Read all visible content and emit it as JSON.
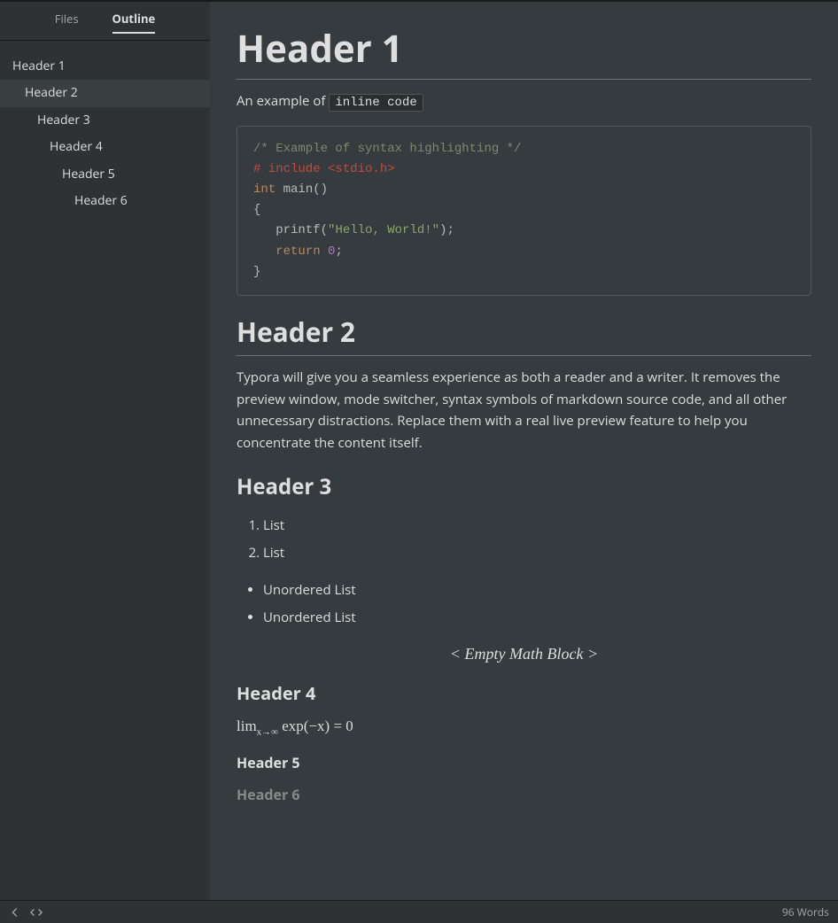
{
  "sidebar": {
    "tabs": {
      "files": "Files",
      "outline": "Outline"
    },
    "outline": [
      {
        "label": "Header 1",
        "level": 1,
        "active": false
      },
      {
        "label": "Header 2",
        "level": 2,
        "active": true
      },
      {
        "label": "Header 3",
        "level": 3,
        "active": false
      },
      {
        "label": "Header 4",
        "level": 4,
        "active": false
      },
      {
        "label": "Header 5",
        "level": 5,
        "active": false
      },
      {
        "label": "Header 6",
        "level": 6,
        "active": false
      }
    ]
  },
  "doc": {
    "h1": "Header 1",
    "p1_prefix": "An example of ",
    "inline_code": "inline code",
    "code": {
      "comment": "/* Example of syntax highlighting */",
      "preproc": "# include <stdio.h>",
      "line3_type": "int",
      "line3_func": "main",
      "line3_rest": "()",
      "line4": "{",
      "line5_func": "printf",
      "line5_paren_open": "(",
      "line5_str": "\"Hello, World!\"",
      "line5_rest": ");",
      "line6_kw": "return",
      "line6_num": "0",
      "line6_semi": ";",
      "line7": "}"
    },
    "h2": "Header 2",
    "p2": "Typora will give you a seamless experience as both a reader and a writer. It removes the preview window, mode switcher, syntax symbols of markdown source code, and all other unnecessary distractions. Replace them with a real live preview feature to help you concentrate the content itself.",
    "h3": "Header 3",
    "ol": [
      "List",
      "List"
    ],
    "ul": [
      "Unordered List",
      "Unordered List"
    ],
    "math_empty": "< Empty Math Block >",
    "h4": "Header 4",
    "math_lim": "lim",
    "math_sub": "x→∞",
    "math_rest": " exp(−x) = 0",
    "h5": "Header 5",
    "h6": "Header 6"
  },
  "status": {
    "words": "96 Words"
  }
}
